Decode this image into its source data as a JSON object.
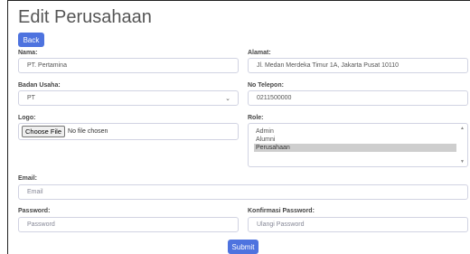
{
  "page": {
    "title": "Edit Perusahaan"
  },
  "buttons": {
    "back": "Back",
    "submit": "Submit"
  },
  "form": {
    "nama": {
      "label": "Nama:",
      "value": "PT. Pertamina"
    },
    "alamat": {
      "label": "Alamat:",
      "value": "Jl. Medan Merdeka Timur 1A, Jakarta Pusat 10110"
    },
    "badan_usaha": {
      "label": "Badan Usaha:",
      "value": "PT"
    },
    "telepon": {
      "label": "No Telepon:",
      "value": "0211500000"
    },
    "logo": {
      "label": "Logo:",
      "button": "Choose File",
      "status": "No file chosen"
    },
    "role": {
      "label": "Role:",
      "options": [
        "Admin",
        "Alumni",
        "Perusahaan"
      ],
      "selected": "Perusahaan"
    },
    "email": {
      "label": "Email:",
      "placeholder": "Email"
    },
    "password": {
      "label": "Password:",
      "placeholder": "Password"
    },
    "konfirmasi": {
      "label": "Konfirmasi Password:",
      "placeholder": "Ulangi Password"
    }
  },
  "colors": {
    "primary": "#4e73df",
    "selected_option": "#cecece",
    "border": "#d1d3e2"
  },
  "icons": {
    "select_caret": "chevron-down-icon"
  }
}
